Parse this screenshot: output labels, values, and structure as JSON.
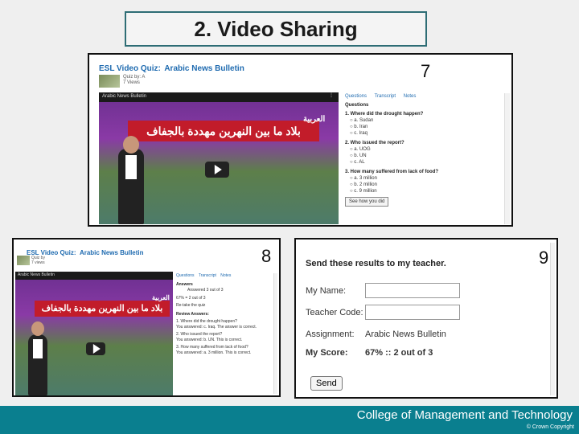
{
  "slide": {
    "title": "2. Video Sharing",
    "footer": "College of Management and Technology",
    "copyright": "© Crown Copyright"
  },
  "shot7": {
    "number": "7",
    "quiz_title": "ESL Video Quiz:",
    "quiz_subtitle": "Arabic News Bulletin",
    "author_line1": "Quiz by: A",
    "author_line2": "7 Views",
    "video_bar": "Arabic News Bulletin",
    "banner": "بلاد ما بين النهرين مهددة بالجفاف",
    "channel_logo": "العربية",
    "tabs": [
      "Questions",
      "Transcript",
      "Notes"
    ],
    "questions_label": "Questions",
    "questions": [
      {
        "q": "1. Where did the drought happen?",
        "opts": [
          "a. Sudan",
          "b. Iran",
          "c. Iraq"
        ]
      },
      {
        "q": "2. Who issued the report?",
        "opts": [
          "a. UOG",
          "b. UN",
          "c. AL"
        ]
      },
      {
        "q": "3. How many suffered from lack of food?",
        "opts": [
          "a. 3 million",
          "b. 2 million",
          "c. 9 million"
        ]
      }
    ],
    "see_how": "See how you did"
  },
  "shot8": {
    "number": "8",
    "quiz_title": "ESL Video Quiz:",
    "quiz_subtitle": "Arabic News Bulletin",
    "author_line1": "Quiz by",
    "author_line2": "7 views",
    "video_bar": "Arabic News Bulletin",
    "banner": "بلاد ما بين النهرين مهددة بالجفاف",
    "channel_logo": "العربية",
    "tabs": [
      "Questions",
      "Transcript",
      "Notes"
    ],
    "answers_label": "Answers",
    "answers_sub": "Answered 3 out of 3",
    "score_line": "67% = 2 out of 3",
    "retake": "Re-take the quiz",
    "review_label": "Review Answers:",
    "review": [
      "1. Where did the drought happen?",
      "You answered: c. Iraq. The answer is correct.",
      "2. Who issued the report?",
      "You answered: b. UN. This is correct.",
      "3. How many suffered from lack of food?",
      "You answered: a. 3 million. This is correct."
    ]
  },
  "shot9": {
    "number": "9",
    "form_title": "Send these results to my teacher.",
    "name_label": "My Name:",
    "teacher_label": "Teacher Code:",
    "assignment_label": "Assignment:",
    "assignment_value": "Arabic News Bulletin",
    "score_label": "My Score:",
    "score_value": "67% :: 2 out of 3",
    "send_label": "Send"
  },
  "colors": {
    "accent": "#0a7f8f",
    "title_border": "#2e6d75",
    "link": "#1f6bb0",
    "banner": "#c21c2a"
  }
}
